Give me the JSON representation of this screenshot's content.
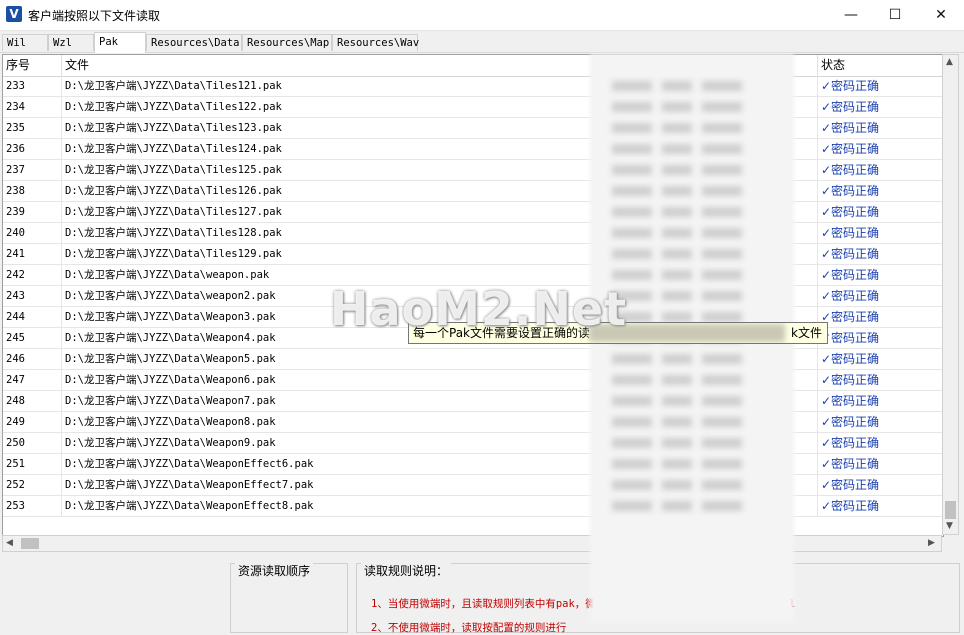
{
  "window": {
    "icon_letter": "V",
    "title": "客户端按照以下文件读取",
    "controls": {
      "minimize": "—",
      "maximize": "☐",
      "close": "✕"
    }
  },
  "tabs": [
    {
      "label": "Wil",
      "active": false
    },
    {
      "label": "Wzl",
      "active": false
    },
    {
      "label": "Pak",
      "active": true
    },
    {
      "label": "Resources\\Data",
      "active": false
    },
    {
      "label": "Resources\\Map",
      "active": false
    },
    {
      "label": "Resources\\Wav",
      "active": false
    }
  ],
  "table": {
    "headers": {
      "num": "序号",
      "file": "文件",
      "status": "状态"
    },
    "rows": [
      {
        "num": "233",
        "file": "D:\\龙卫客户端\\JYZZ\\Data\\Tiles121.pak",
        "status": "✓密码正确"
      },
      {
        "num": "234",
        "file": "D:\\龙卫客户端\\JYZZ\\Data\\Tiles122.pak",
        "status": "✓密码正确"
      },
      {
        "num": "235",
        "file": "D:\\龙卫客户端\\JYZZ\\Data\\Tiles123.pak",
        "status": "✓密码正确"
      },
      {
        "num": "236",
        "file": "D:\\龙卫客户端\\JYZZ\\Data\\Tiles124.pak",
        "status": "✓密码正确"
      },
      {
        "num": "237",
        "file": "D:\\龙卫客户端\\JYZZ\\Data\\Tiles125.pak",
        "status": "✓密码正确"
      },
      {
        "num": "238",
        "file": "D:\\龙卫客户端\\JYZZ\\Data\\Tiles126.pak",
        "status": "✓密码正确"
      },
      {
        "num": "239",
        "file": "D:\\龙卫客户端\\JYZZ\\Data\\Tiles127.pak",
        "status": "✓密码正确"
      },
      {
        "num": "240",
        "file": "D:\\龙卫客户端\\JYZZ\\Data\\Tiles128.pak",
        "status": "✓密码正确"
      },
      {
        "num": "241",
        "file": "D:\\龙卫客户端\\JYZZ\\Data\\Tiles129.pak",
        "status": "✓密码正确"
      },
      {
        "num": "242",
        "file": "D:\\龙卫客户端\\JYZZ\\Data\\weapon.pak",
        "status": "✓密码正确"
      },
      {
        "num": "243",
        "file": "D:\\龙卫客户端\\JYZZ\\Data\\weapon2.pak",
        "status": "✓密码正确"
      },
      {
        "num": "244",
        "file": "D:\\龙卫客户端\\JYZZ\\Data\\Weapon3.pak",
        "status": "✓密码正确"
      },
      {
        "num": "245",
        "file": "D:\\龙卫客户端\\JYZZ\\Data\\Weapon4.pak",
        "status": "✓密码正确"
      },
      {
        "num": "246",
        "file": "D:\\龙卫客户端\\JYZZ\\Data\\Weapon5.pak",
        "status": "✓密码正确"
      },
      {
        "num": "247",
        "file": "D:\\龙卫客户端\\JYZZ\\Data\\Weapon6.pak",
        "status": "✓密码正确"
      },
      {
        "num": "248",
        "file": "D:\\龙卫客户端\\JYZZ\\Data\\Weapon7.pak",
        "status": "✓密码正确"
      },
      {
        "num": "249",
        "file": "D:\\龙卫客户端\\JYZZ\\Data\\Weapon8.pak",
        "status": "✓密码正确"
      },
      {
        "num": "250",
        "file": "D:\\龙卫客户端\\JYZZ\\Data\\Weapon9.pak",
        "status": "✓密码正确"
      },
      {
        "num": "251",
        "file": "D:\\龙卫客户端\\JYZZ\\Data\\WeaponEffect6.pak",
        "status": "✓密码正确"
      },
      {
        "num": "252",
        "file": "D:\\龙卫客户端\\JYZZ\\Data\\WeaponEffect7.pak",
        "status": "✓密码正确"
      },
      {
        "num": "253",
        "file": "D:\\龙卫客户端\\JYZZ\\Data\\WeaponEffect8.pak",
        "status": "✓密码正确"
      }
    ]
  },
  "scrollbars": {
    "up": "▲",
    "down": "▼",
    "left": "◀",
    "right": "▶"
  },
  "tooltip": {
    "part1": "每一个Pak文件需要设置正确的读",
    "part2": "k文件"
  },
  "watermark": "HaoM2.Net",
  "bottom": {
    "order_label": "资源读取顺序",
    "rules_label": "读取规则说明：",
    "rule1": "1、当使用微端时，且读取规则列表中有pak，微端直接请求更新pak，而不再读 wzl，wil",
    "rule2": "2、不使用微端时，读取按配置的规则进行"
  },
  "colors": {
    "status_text": "#1a3fb0",
    "rule_text": "#c00000",
    "tooltip_bg": "#ffffe1"
  }
}
